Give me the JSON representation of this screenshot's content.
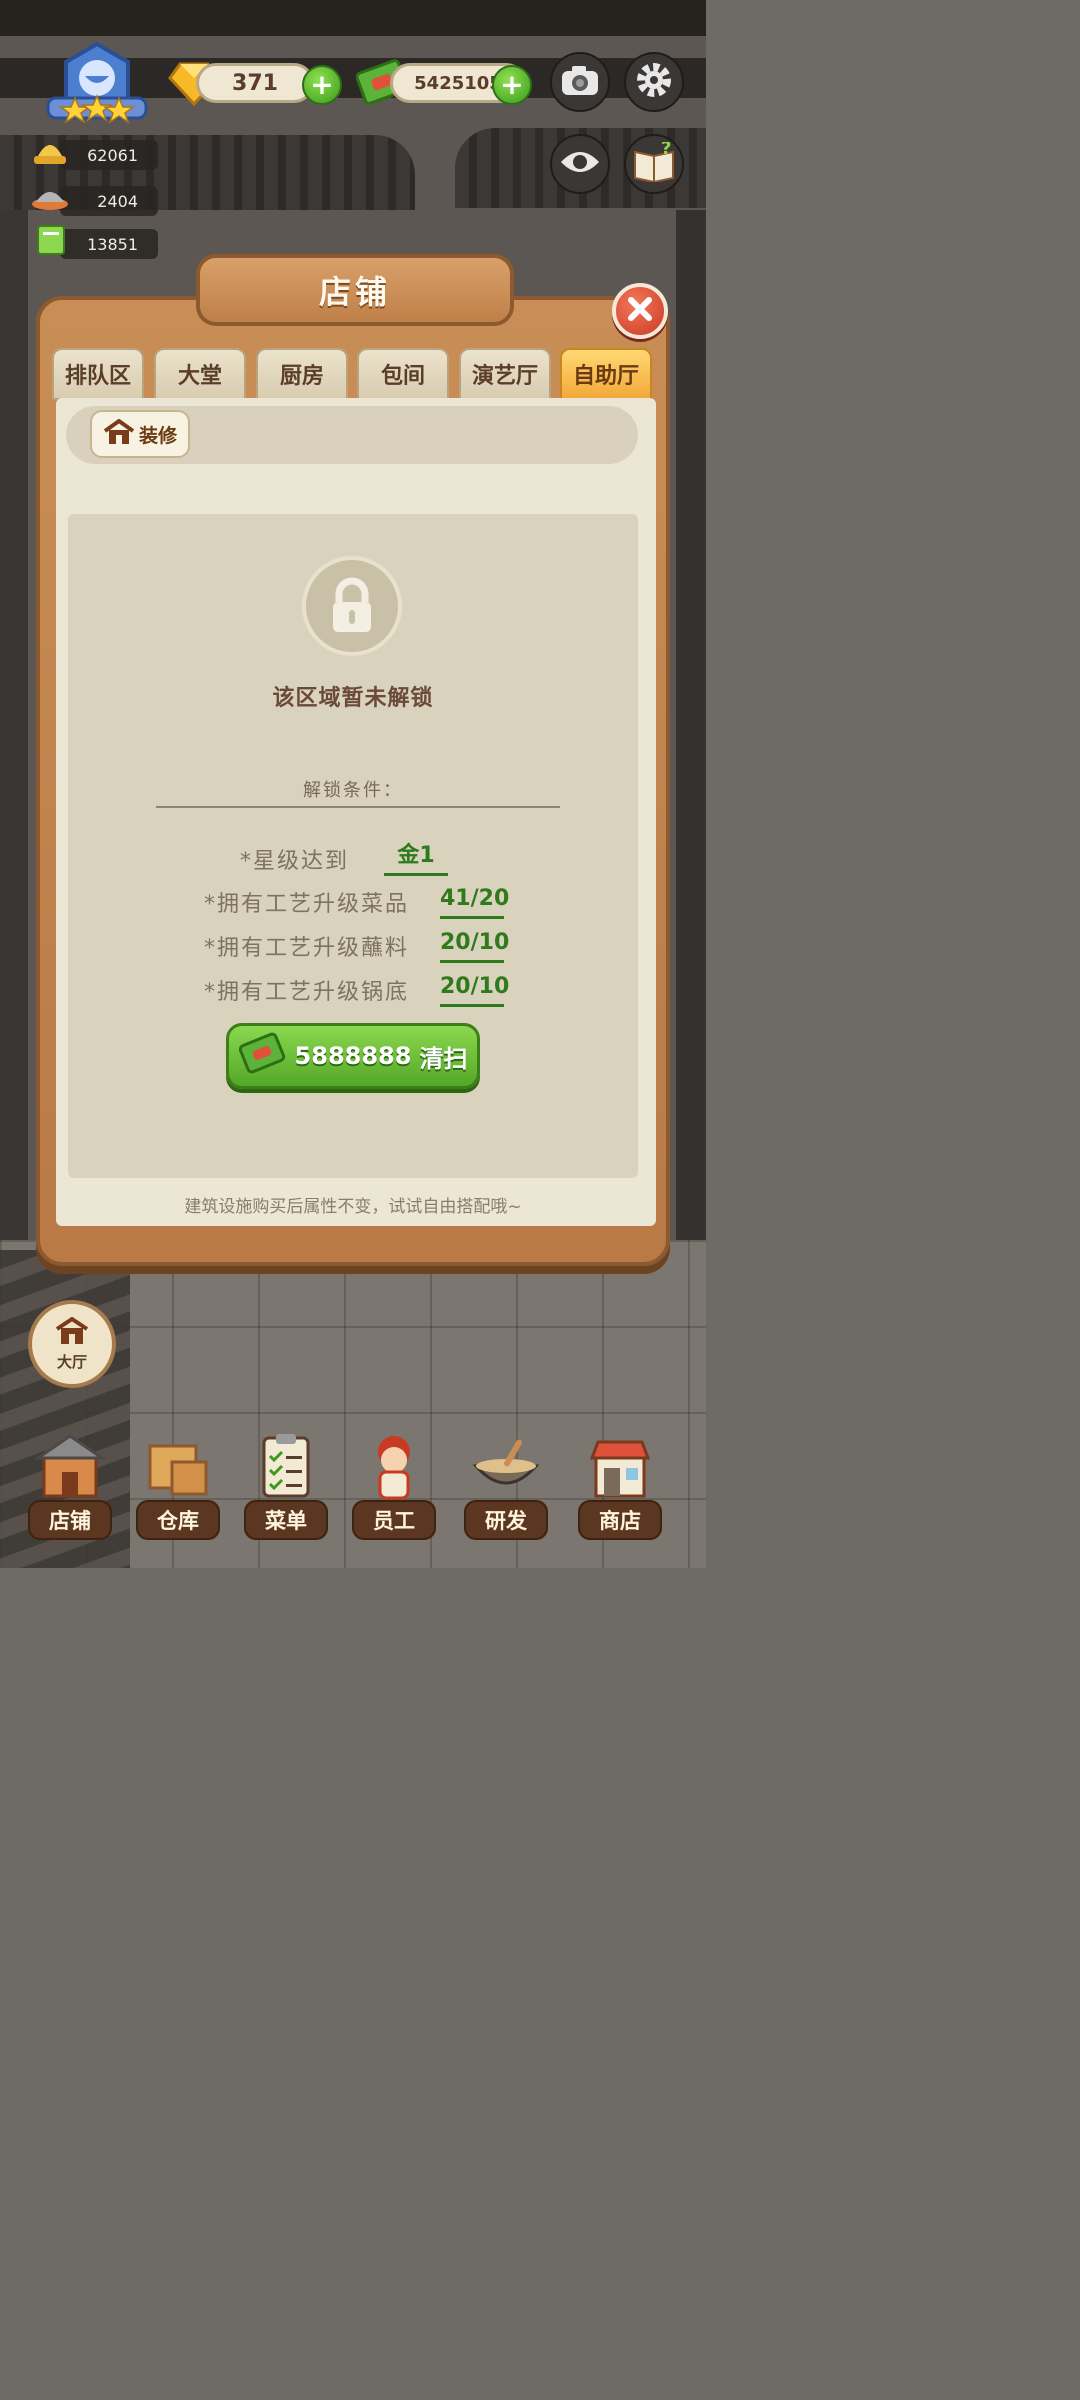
{
  "hud": {
    "gems": "371",
    "cash": "5425105",
    "stats": [
      "62061",
      "2404",
      "13851"
    ]
  },
  "modal": {
    "title": "店铺",
    "tabs": [
      "排队区",
      "大堂",
      "厨房",
      "包间",
      "演艺厅",
      "自助厅"
    ],
    "active_tab": "自助厅",
    "decorate_label": "装修",
    "locked_text": "该区域暂未解锁",
    "conditions_title": "解锁条件：",
    "conditions": [
      {
        "label": "*星级达到",
        "value": "金1"
      },
      {
        "label": "*拥有工艺升级菜品",
        "value": "41/20"
      },
      {
        "label": "*拥有工艺升级蘸料",
        "value": "20/10"
      },
      {
        "label": "*拥有工艺升级锅底",
        "value": "20/10"
      }
    ],
    "sweep_price": "5888888",
    "sweep_label": "清扫",
    "hint": "建筑设施购买后属性不变，试试自由搭配哦~"
  },
  "hall_button": "大厅",
  "nav": [
    "店铺",
    "仓库",
    "菜单",
    "员工",
    "研发",
    "商店"
  ],
  "colors": {
    "accent_green": "#53a827",
    "active_tab": "#f3a93a",
    "frame_wood": "#c98e56",
    "close_red": "#c93a22"
  },
  "icons": [
    "rank-badge-icon",
    "gem-icon",
    "cash-icon",
    "camera-icon",
    "gear-icon",
    "eye-icon",
    "help-book-icon",
    "close-icon",
    "house-icon",
    "lock-icon"
  ]
}
